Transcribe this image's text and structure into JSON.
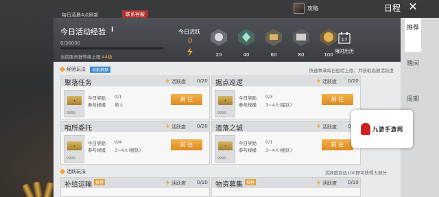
{
  "top": {
    "refresh_note": "每日凌晨4点刷新",
    "badge": "联系客服",
    "guide_label": "攻略",
    "schedule_title": "日程"
  },
  "header": {
    "title": "今日活动经验",
    "xp_current": "0",
    "xp_sep": "/",
    "xp_max": "36000",
    "xp_progress": 0,
    "level_label": "当前服务器等级上限:",
    "level_value": "44级",
    "activity_label": "今日活跃",
    "activity_value": "0",
    "reward_thresholds": [
      "20",
      "40",
      "60",
      "80",
      "100"
    ],
    "history_label": "限时历历",
    "calendar_day": "17"
  },
  "sections": {
    "exp_play": {
      "title": "经验玩法",
      "badge": "当前推荐",
      "note": "快速事满每日经验上限，并获取高额活跃度"
    },
    "active_play": {
      "title": "活跃玩法",
      "note": "活跃度到达100即可获得大部分"
    }
  },
  "card_labels": {
    "today_reward": "今日奖励",
    "rule": "参与规模",
    "activity": "活跃度",
    "go": "前 往"
  },
  "cards": [
    {
      "title": "聚落任务",
      "progress": "0/20",
      "reward": "0/1",
      "rule": "单人",
      "ticket": "9999"
    },
    {
      "title": "据点巡逻",
      "progress": "0/20",
      "reward": "0/3",
      "rule": "3~4人(组队)",
      "ticket": "9999"
    },
    {
      "title": "哨所委托",
      "progress": "0/20",
      "reward": "0/4",
      "rule": "3~4人(组队)",
      "ticket": "9999"
    },
    {
      "title": "遗落之城",
      "progress": "0/20",
      "reward": "0/1",
      "rule": "3~4人(组队)",
      "ticket": "9999"
    },
    {
      "title": "补给运输",
      "badge": "推荐",
      "progress": "0/10"
    },
    {
      "title": "物资募集",
      "badge": "推荐",
      "progress": "0/10"
    }
  ],
  "side_tabs": [
    "推荐",
    "晚间",
    "周期"
  ],
  "watermark": "九游手游网"
}
